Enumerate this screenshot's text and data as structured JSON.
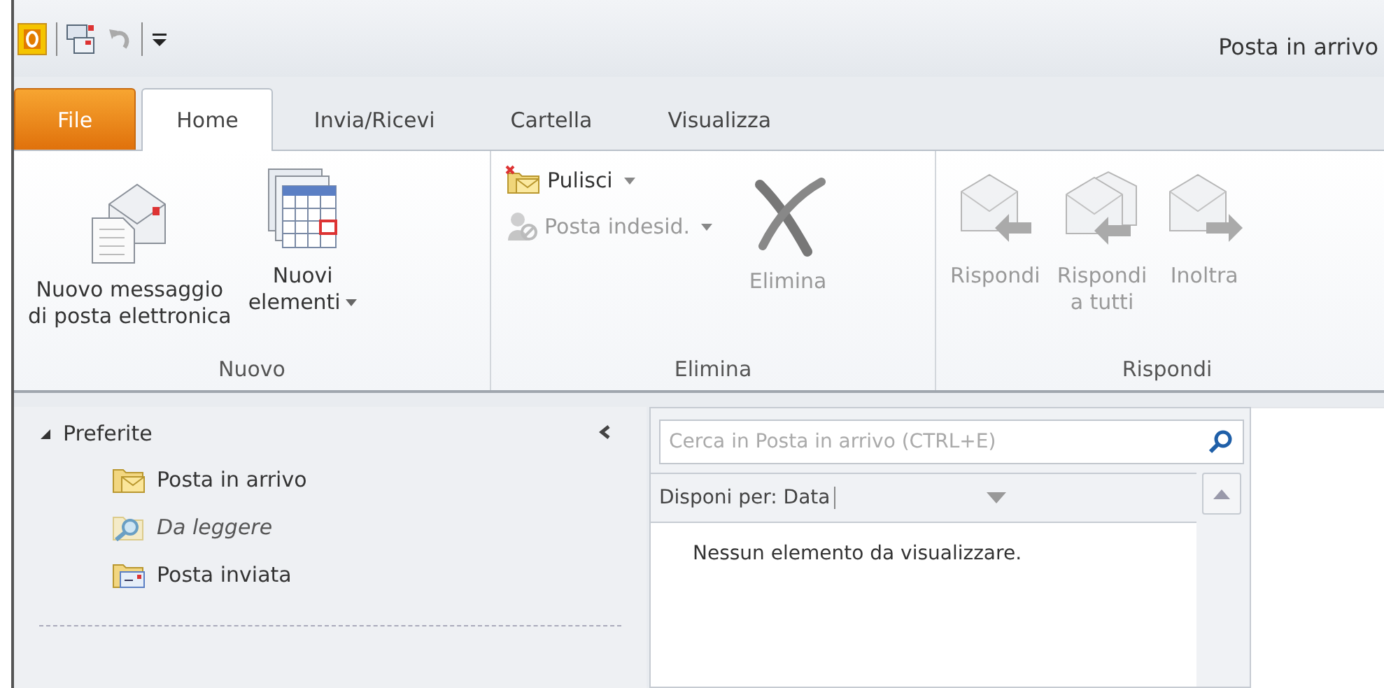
{
  "window": {
    "title": "Posta in arrivo"
  },
  "tabs": [
    {
      "label": "File",
      "kind": "file",
      "selected": false
    },
    {
      "label": "Home",
      "kind": "tab",
      "selected": true
    },
    {
      "label": "Invia/Ricevi",
      "kind": "tab",
      "selected": false
    },
    {
      "label": "Cartella",
      "kind": "tab",
      "selected": false
    },
    {
      "label": "Visualizza",
      "kind": "tab",
      "selected": false
    }
  ],
  "ribbon_groups": [
    {
      "label": "Nuovo",
      "buttons": [
        {
          "label": "Nuovo messaggio\ndi posta elettronica",
          "kind": "large",
          "dropdown": false,
          "disabled": false
        },
        {
          "label": "Nuovi\nelementi",
          "kind": "large",
          "dropdown": true,
          "disabled": false
        }
      ]
    },
    {
      "label": "Elimina",
      "buttons": [
        {
          "label": "Pulisci",
          "kind": "small",
          "dropdown": true,
          "disabled": false
        },
        {
          "label": "Posta indesid.",
          "kind": "small",
          "dropdown": true,
          "disabled": true
        },
        {
          "label": "Elimina",
          "kind": "large",
          "dropdown": false,
          "disabled": true
        }
      ]
    },
    {
      "label": "Rispondi",
      "buttons": [
        {
          "label": "Rispondi",
          "kind": "large",
          "dropdown": false,
          "disabled": true
        },
        {
          "label": "Rispondi\na tutti",
          "kind": "large",
          "dropdown": false,
          "disabled": true
        },
        {
          "label": "Inoltra",
          "kind": "large",
          "dropdown": false,
          "disabled": true
        }
      ]
    }
  ],
  "navigation": {
    "section": {
      "label": "Preferite",
      "expanded": true
    },
    "items": [
      {
        "label": "Posta in arrivo",
        "kind": "inbox"
      },
      {
        "label": "Da leggere",
        "kind": "search_folder"
      },
      {
        "label": "Posta inviata",
        "kind": "sent"
      }
    ]
  },
  "message_list": {
    "search": {
      "placeholder": "Cerca in Posta in arrivo (CTRL+E)"
    },
    "arrange_by": "Disponi per: Data",
    "empty_message": "Nessun elemento da visualizzare."
  }
}
